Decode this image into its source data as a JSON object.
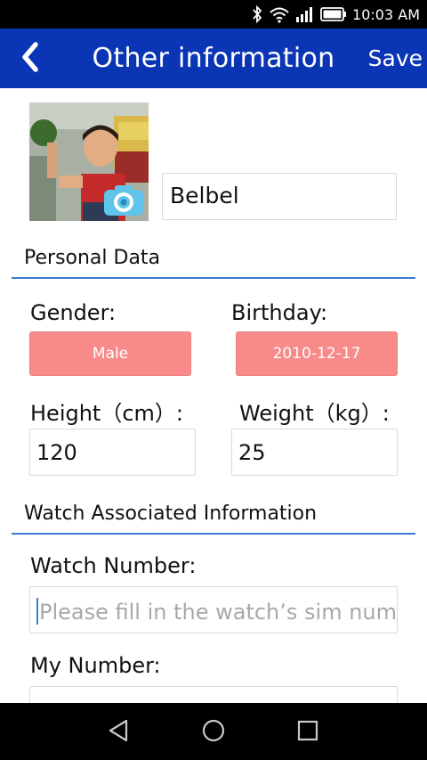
{
  "status_bar": {
    "time": "10:03 AM",
    "icons": [
      "bluetooth-icon",
      "wifi-icon",
      "signal-icon",
      "battery-icon"
    ]
  },
  "app_bar": {
    "title": "Other information",
    "save_label": "Save",
    "back_icon": "chevron-left-icon"
  },
  "profile": {
    "name_value": "Belbel",
    "avatar_icon": "camera-icon"
  },
  "personal_data": {
    "section_title": "Personal Data",
    "gender_label": "Gender:",
    "gender_value": "Male",
    "birthday_label": "Birthday:",
    "birthday_value": "2010-12-17",
    "height_label": "Height（cm）:",
    "height_value": "120",
    "weight_label": "Weight（kg）:",
    "weight_value": "25"
  },
  "watch_info": {
    "section_title": "Watch Associated Information",
    "watch_number_label": "Watch Number:",
    "watch_number_placeholder": "Please fill in the watch’s sim numb",
    "my_number_label": "My Number:"
  },
  "colors": {
    "app_bar": "#0a36b6",
    "divider": "#3b7bd1",
    "pink_button": "#f88a8a"
  },
  "nav_bar": {
    "icons": [
      "back-triangle-icon",
      "home-circle-icon",
      "recents-square-icon"
    ]
  }
}
